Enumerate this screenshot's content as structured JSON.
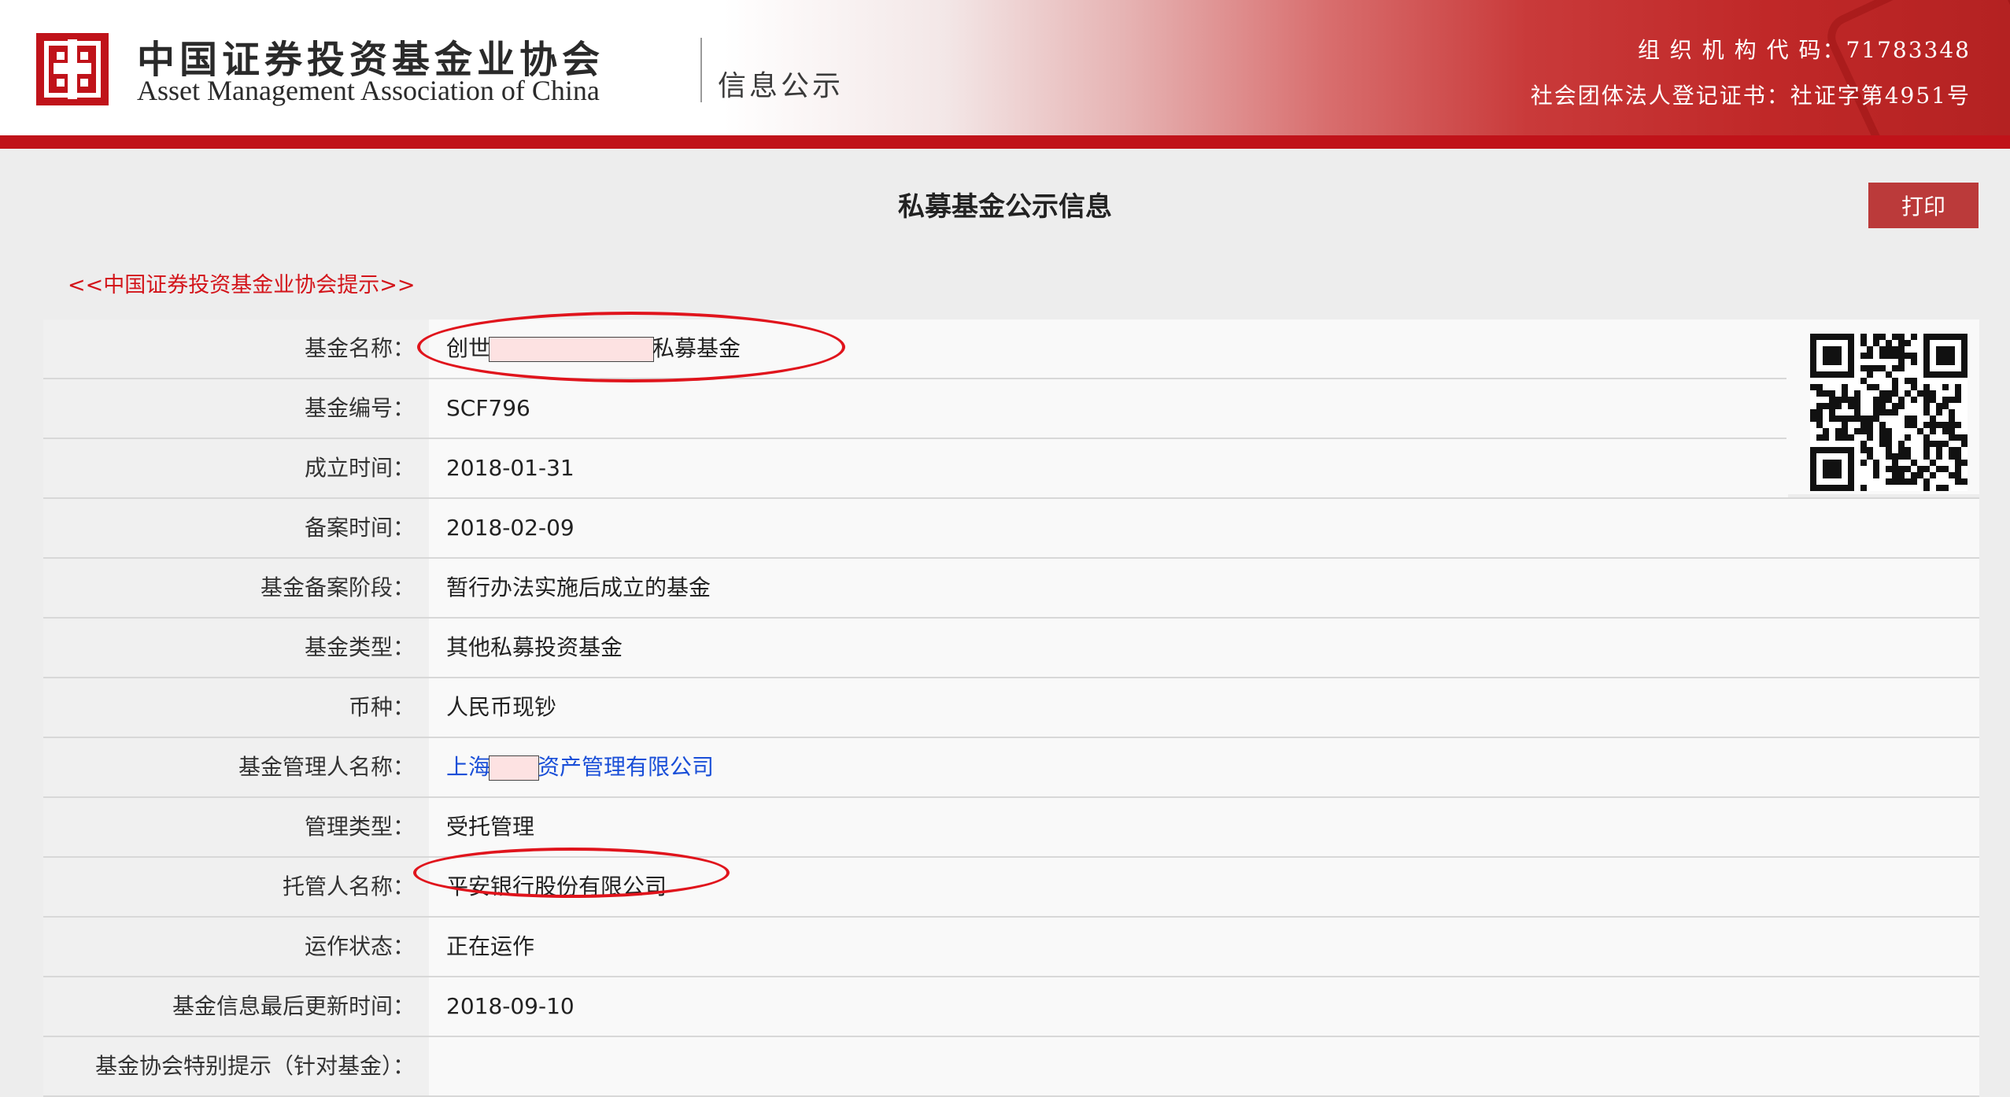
{
  "header": {
    "org_name_cn": "中国证券投资基金业协会",
    "org_name_en": "Asset Management Association of China",
    "section": "信息公示",
    "org_code": "组 织 机 构 代 码：71783348",
    "registration": "社会团体法人登记证书：社证字第4951号"
  },
  "page": {
    "title": "私募基金公示信息",
    "print_label": "打印",
    "hint_link": "<<中国证券投资基金业协会提示>>"
  },
  "fund_info": {
    "name_label": "基金名称：",
    "name_prefix": "创世",
    "name_suffix": "私募基金",
    "code_label": "基金编号：",
    "code": "SCF796",
    "established_label": "成立时间：",
    "established": "2018-01-31",
    "filed_label": "备案时间：",
    "filed": "2018-02-09",
    "stage_label": "基金备案阶段：",
    "stage": "暂行办法实施后成立的基金",
    "type_label": "基金类型：",
    "type": "其他私募投资基金",
    "currency_label": "币种：",
    "currency": "人民币现钞",
    "manager_label": "基金管理人名称：",
    "manager_prefix": "上海",
    "manager_suffix": "资产管理有限公司",
    "mgmt_type_label": "管理类型：",
    "mgmt_type": "受托管理",
    "custodian_label": "托管人名称：",
    "custodian": "平安银行股份有限公司",
    "status_label": "运作状态：",
    "status": "正在运作",
    "updated_label": "基金信息最后更新时间：",
    "updated": "2018-09-10",
    "special_label": "基金协会特别提示（针对基金）：",
    "special": ""
  },
  "colors": {
    "brand_red": "#c0131a",
    "button_red": "#bb3a3a",
    "link_blue": "#1a4fd8",
    "annotation_red": "#e0141c"
  }
}
